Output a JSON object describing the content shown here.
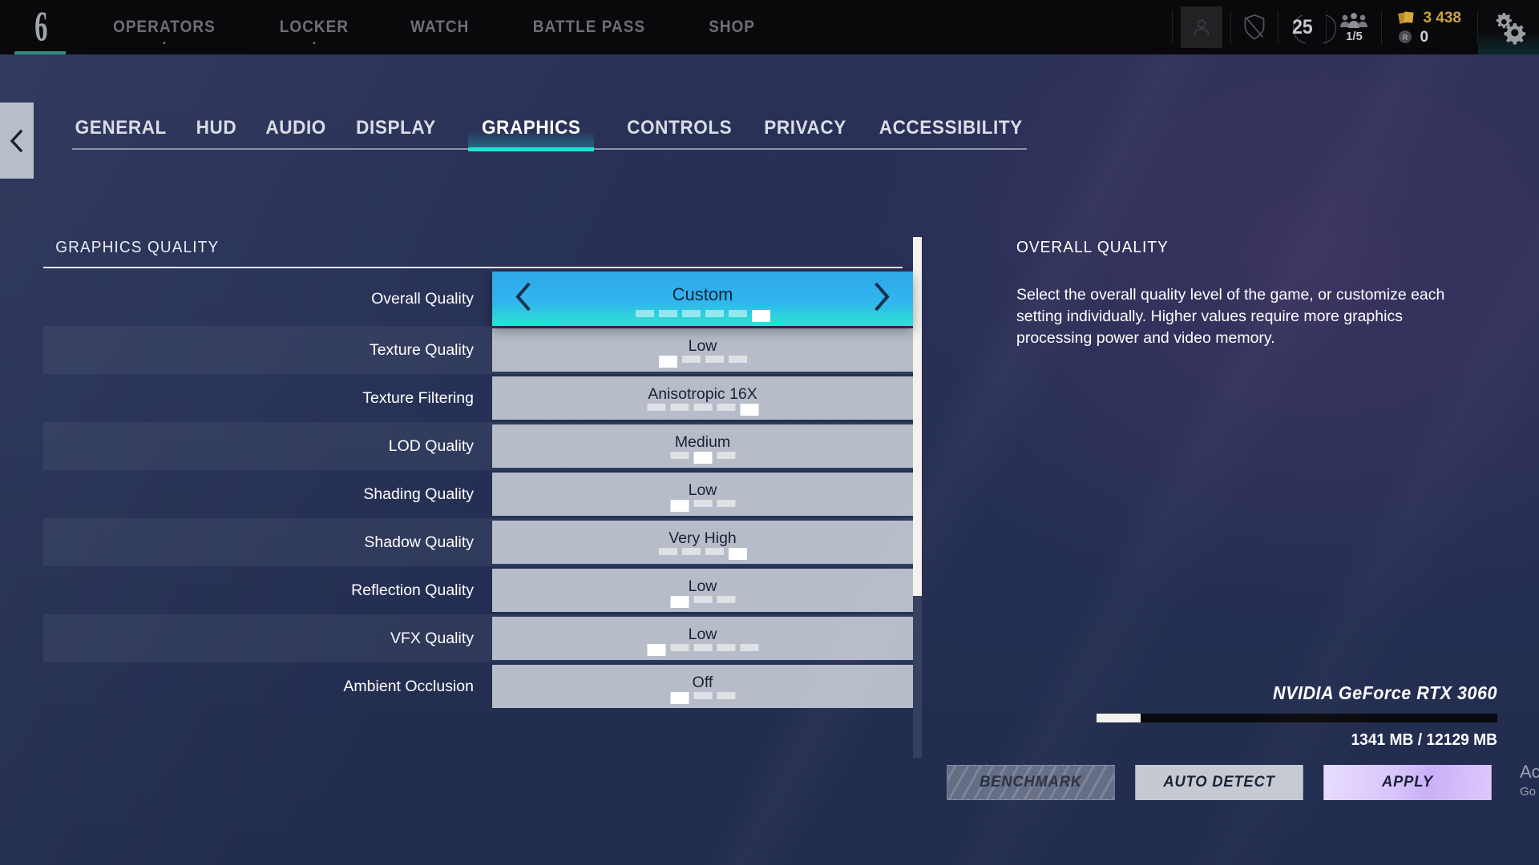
{
  "topbar": {
    "logo": "r6-siege-logo",
    "nav": [
      {
        "label": "OPERATORS",
        "has_dot": true
      },
      {
        "label": "LOCKER",
        "has_dot": true
      },
      {
        "label": "WATCH",
        "has_dot": false
      },
      {
        "label": "BATTLE PASS",
        "has_dot": false
      },
      {
        "label": "SHOP",
        "has_dot": false
      }
    ],
    "avatar": "player-avatar",
    "shield_icon": "shield-icon",
    "level": "25",
    "squad_icon": "squad-icon",
    "squad_count": "1/5",
    "renown_icon": "renown-icon",
    "renown": "3 438",
    "credits_icon": "r6-credits-icon",
    "credits": "0",
    "gear_icon": "settings-gear-icon"
  },
  "back_button": {
    "icon": "chevron-left-icon"
  },
  "tabs": [
    {
      "label": "GENERAL",
      "active": false
    },
    {
      "label": "HUD",
      "active": false
    },
    {
      "label": "AUDIO",
      "active": false
    },
    {
      "label": "DISPLAY",
      "active": false
    },
    {
      "label": "GRAPHICS",
      "active": true
    },
    {
      "label": "CONTROLS",
      "active": false
    },
    {
      "label": "PRIVACY",
      "active": false
    },
    {
      "label": "ACCESSIBILITY",
      "active": false
    }
  ],
  "left_panel": {
    "section_title": "GRAPHICS QUALITY",
    "rows": [
      {
        "label": "Overall Quality",
        "value": "Custom",
        "segments": 6,
        "selected_index": 5,
        "highlighted": true,
        "striped": false
      },
      {
        "label": "Texture Quality",
        "value": "Low",
        "segments": 4,
        "selected_index": 0,
        "highlighted": false,
        "striped": true
      },
      {
        "label": "Texture Filtering",
        "value": "Anisotropic 16X",
        "segments": 5,
        "selected_index": 4,
        "highlighted": false,
        "striped": false
      },
      {
        "label": "LOD Quality",
        "value": "Medium",
        "segments": 3,
        "selected_index": 1,
        "highlighted": false,
        "striped": true
      },
      {
        "label": "Shading Quality",
        "value": "Low",
        "segments": 3,
        "selected_index": 0,
        "highlighted": false,
        "striped": false
      },
      {
        "label": "Shadow Quality",
        "value": "Very High",
        "segments": 4,
        "selected_index": 3,
        "highlighted": false,
        "striped": true
      },
      {
        "label": "Reflection Quality",
        "value": "Low",
        "segments": 3,
        "selected_index": 0,
        "highlighted": false,
        "striped": false
      },
      {
        "label": "VFX Quality",
        "value": "Low",
        "segments": 5,
        "selected_index": 0,
        "highlighted": false,
        "striped": true
      },
      {
        "label": "Ambient Occlusion",
        "value": "Off",
        "segments": 3,
        "selected_index": 0,
        "highlighted": false,
        "striped": false
      }
    ],
    "prev_arrow_icon": "chevron-left-icon",
    "next_arrow_icon": "chevron-right-icon",
    "scroll_position_percent": 0
  },
  "right_panel": {
    "title": "OVERALL QUALITY",
    "description": "Select the overall quality level of the game, or customize each setting individually. Higher values require more graphics processing power and video memory.",
    "gpu_name": "NVIDIA GeForce RTX 3060",
    "vram_used": "1341 MB",
    "vram_total": "12129 MB",
    "vram_text": "1341 MB / 12129 MB",
    "vram_percent": 11
  },
  "buttons": [
    {
      "label": "BENCHMARK",
      "state": "disabled"
    },
    {
      "label": "AUTO DETECT",
      "state": "neutral"
    },
    {
      "label": "APPLY",
      "state": "primary"
    }
  ],
  "watermark": {
    "line1": "Activate Windows",
    "line2": "Go to Settings to activate Windows."
  },
  "colors": {
    "accent_teal": "#21e3d4",
    "accent_blue": "#2fa8e8",
    "apply_purple": "#d8c5fb",
    "renown_gold": "#caa33f",
    "panel_bg": "#263055",
    "control_gray": "#b6bcc8"
  }
}
